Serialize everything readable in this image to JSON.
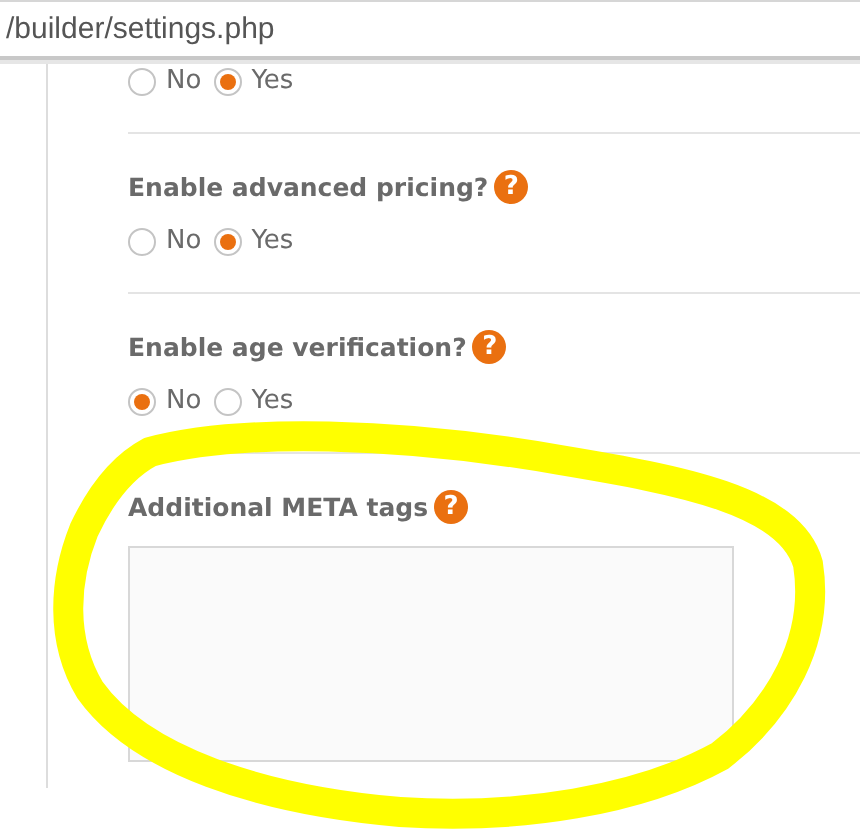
{
  "address_bar": {
    "url": "/builder/settings.php"
  },
  "settings": [
    {
      "kind": "radio",
      "options": [
        {
          "label": "No",
          "selected": false
        },
        {
          "label": "Yes",
          "selected": true
        }
      ]
    },
    {
      "kind": "radio",
      "label": "Enable advanced pricing?",
      "help": "?",
      "options": [
        {
          "label": "No",
          "selected": false
        },
        {
          "label": "Yes",
          "selected": true
        }
      ]
    },
    {
      "kind": "radio",
      "label": "Enable age verification?",
      "help": "?",
      "options": [
        {
          "label": "No",
          "selected": true
        },
        {
          "label": "Yes",
          "selected": false
        }
      ]
    },
    {
      "kind": "textarea",
      "label": "Additional META tags",
      "help": "?"
    }
  ],
  "annotation": {
    "kind": "freehand-ellipse"
  }
}
